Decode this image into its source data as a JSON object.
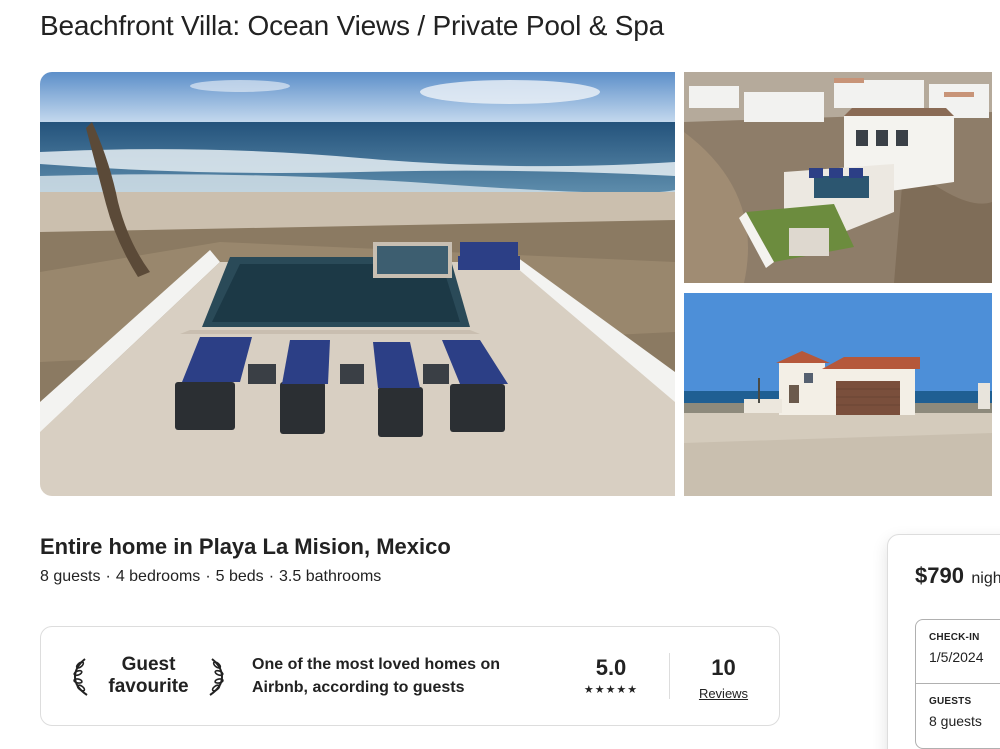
{
  "listing": {
    "title": "Beachfront Villa: Ocean Views / Private Pool & Spa",
    "subtitle": "Entire home in Playa La Mision, Mexico",
    "details": [
      "8 guests",
      "4 bedrooms",
      "5 beds",
      "3.5 bathrooms"
    ],
    "detail_separator": "·"
  },
  "photos": [
    {
      "name": "pool-deck-ocean-view"
    },
    {
      "name": "aerial-villa-view"
    },
    {
      "name": "villa-exterior-garage"
    }
  ],
  "guest_favourite": {
    "badge_line1": "Guest",
    "badge_line2": "favourite",
    "description": "One of the most loved homes on Airbnb, according to guests",
    "rating": "5.0",
    "stars": "★★★★★",
    "reviews_count": "10",
    "reviews_label": "Reviews"
  },
  "booking": {
    "price": "$790",
    "price_unit": "night",
    "checkin_label": "CHECK-IN",
    "checkin_value": "1/5/2024",
    "guests_label": "GUESTS",
    "guests_value": "8 guests"
  },
  "colors": {
    "text": "#222222",
    "border": "#dddddd",
    "ocean": "#2f5f86",
    "sky": "#7fb2e0"
  }
}
